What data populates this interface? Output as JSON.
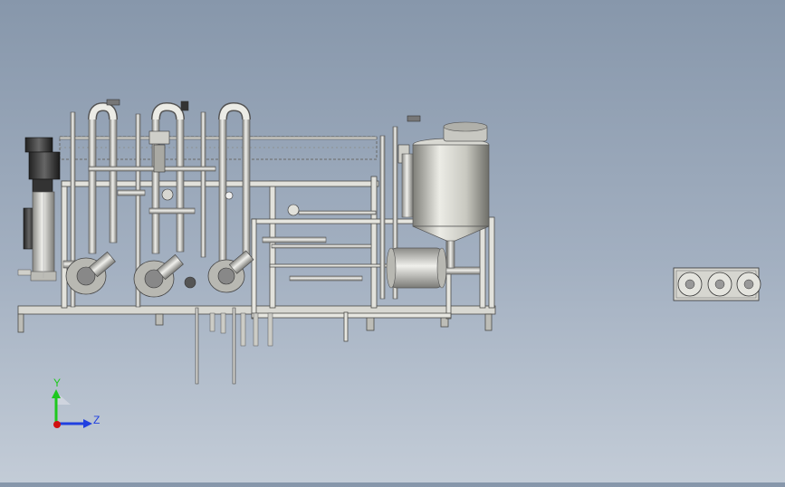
{
  "axes": {
    "y_label": "Y",
    "z_label": "Z",
    "y_color": "#1ec81e",
    "z_color": "#2040e0",
    "origin_color": "#d01010"
  },
  "colors": {
    "background_top": "#8797ab",
    "background_bottom": "#c3ccd7",
    "metal_light": "#e6e6e2",
    "metal_mid": "#b4b4ae",
    "metal_dark": "#6e6e6a",
    "frame": "#d8d8d2",
    "line": "#4a4a48"
  },
  "parts": {
    "motor": "motor-icon",
    "tank": "tank-icon",
    "pump": "pump-icon",
    "flange_view": "flange-plate-icon"
  }
}
